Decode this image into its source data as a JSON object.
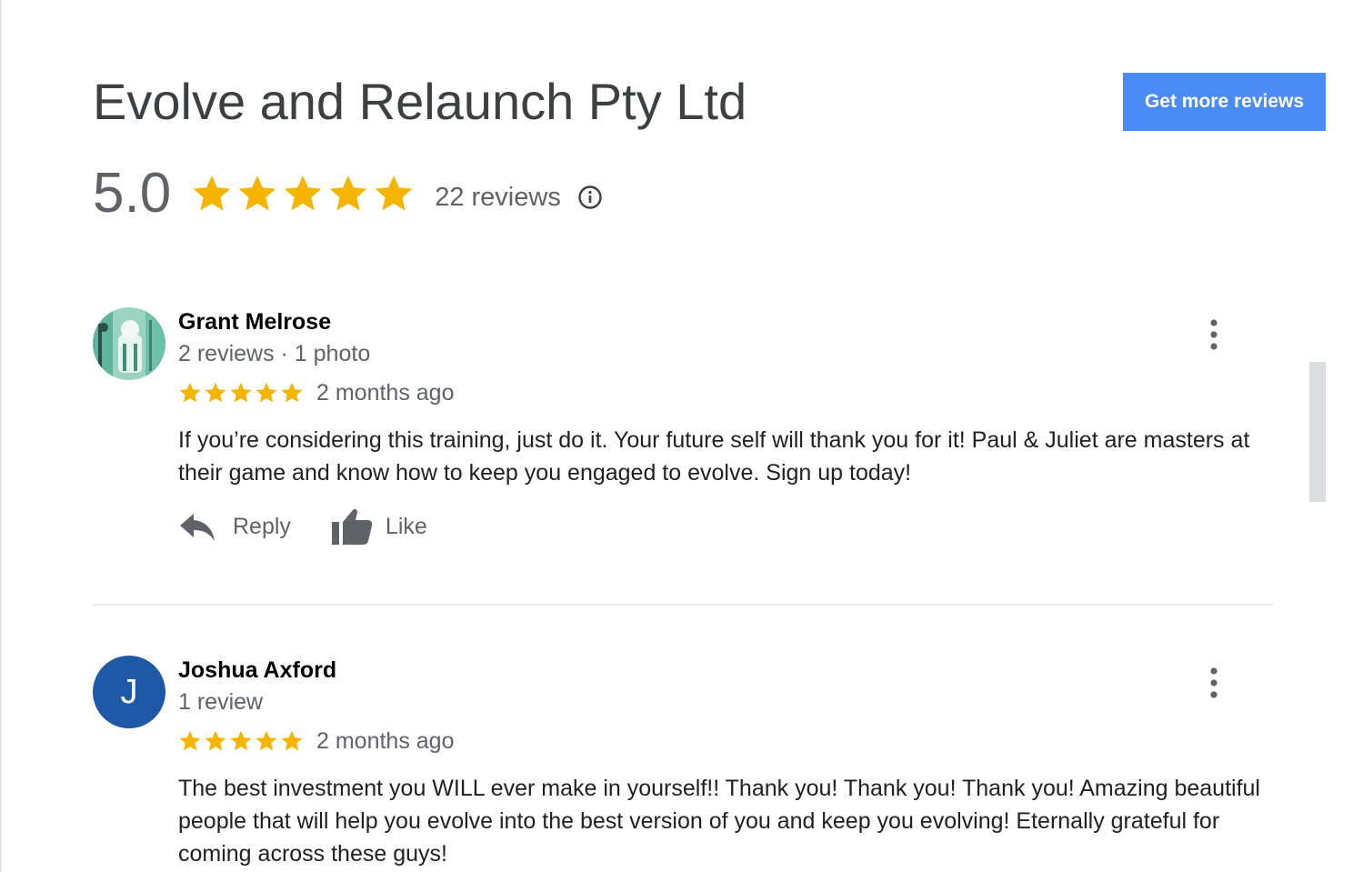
{
  "business": {
    "name": "Evolve and Relaunch Pty Ltd",
    "cta_label": "Get more reviews",
    "rating": "5.0",
    "stars": 5,
    "review_count": "22 reviews"
  },
  "colors": {
    "star": "#f4b400",
    "cta": "#4b8bf5",
    "avatar_j": "#1e58a6"
  },
  "icons": [
    "info-icon",
    "more-vert-icon",
    "reply-icon",
    "thumbs-up-icon",
    "star-icon"
  ],
  "reviews": [
    {
      "name": "Grant Melrose",
      "meta": "2 reviews · 1 photo",
      "rating": 5,
      "date": "2 months ago",
      "text": "If you’re considering this training, just do it. Your future self will thank you for it! Paul & Juliet are masters at their game and know how to keep you engaged to evolve. Sign up today!",
      "reply_label": "Reply",
      "like_label": "Like",
      "avatar_type": "photo"
    },
    {
      "name": "Joshua Axford",
      "meta": "1 review",
      "rating": 5,
      "date": "2 months ago",
      "text": "The best investment you WILL ever make in yourself!! Thank you! Thank you! Thank you! Amazing beautiful people that will help you evolve into the best version of you and keep you evolving! Eternally grateful for coming across these guys!",
      "avatar_letter": "J",
      "avatar_type": "letter"
    }
  ]
}
